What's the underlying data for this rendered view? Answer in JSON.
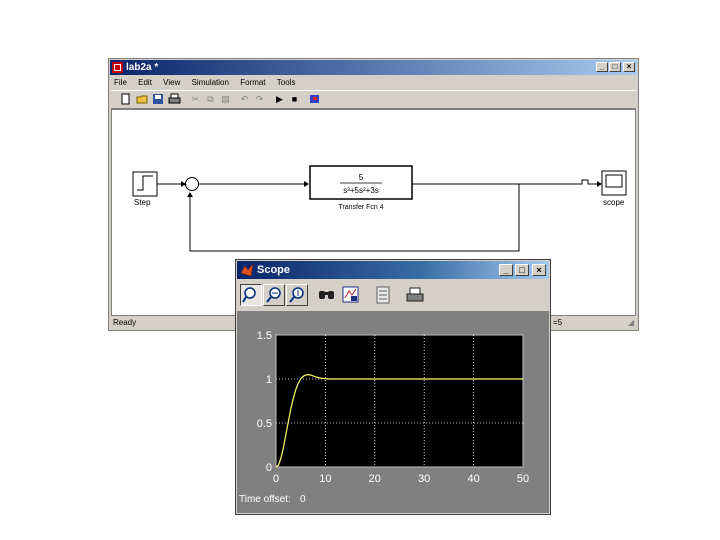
{
  "model_window": {
    "title": "lab2a *",
    "menu": [
      "File",
      "Edit",
      "View",
      "Simulation",
      "Format",
      "Tools"
    ],
    "toolbar": [
      "new-file-icon",
      "open-folder-icon",
      "save-icon",
      "print-icon",
      "cut-icon",
      "copy-icon",
      "paste-icon",
      "undo-icon",
      "redo-icon",
      "start-simulation-icon",
      "stop-simulation-icon",
      "library-browser-icon"
    ],
    "status_left": "Ready",
    "status_right": "=5",
    "blocks": {
      "step_label": "Step",
      "sum_sign": "+",
      "tf_numerator": "5",
      "tf_denominator": "s³+5s²+3s",
      "tf_label": "Transfer Fcn 4",
      "scope_label": "scope"
    }
  },
  "scope_window": {
    "title": "Scope",
    "toolbar": [
      "zoom-icon",
      "zoom-x-icon",
      "zoom-y-icon",
      "autoscale-icon",
      "save-axes-icon",
      "parameters-icon",
      "print-icon"
    ],
    "time_offset_label": "Time offset:",
    "time_offset_value": "0"
  },
  "chart_data": {
    "type": "line",
    "title": "",
    "xlabel": "",
    "ylabel": "",
    "xlim": [
      0,
      50
    ],
    "ylim": [
      0,
      1.5
    ],
    "xticks": [
      "0",
      "10",
      "20",
      "30",
      "40",
      "50"
    ],
    "yticks": [
      "0",
      "0.5",
      "1",
      "1.5"
    ],
    "grid": true,
    "background": "#000000",
    "line_color": "#ffff66",
    "series": [
      {
        "x": [
          0,
          0.5,
          1,
          1.5,
          2,
          2.5,
          3,
          3.5,
          4,
          4.5,
          5,
          5.5,
          6,
          6.5,
          7,
          7.5,
          8,
          9,
          10,
          11,
          12,
          15,
          20,
          30,
          40,
          50
        ],
        "values": [
          0,
          0.02,
          0.1,
          0.22,
          0.37,
          0.52,
          0.66,
          0.78,
          0.88,
          0.95,
          1.0,
          1.03,
          1.045,
          1.05,
          1.045,
          1.035,
          1.025,
          1.01,
          1.003,
          1.0,
          1.0,
          1.0,
          1.0,
          1.0,
          1.0,
          1.0
        ]
      }
    ]
  }
}
